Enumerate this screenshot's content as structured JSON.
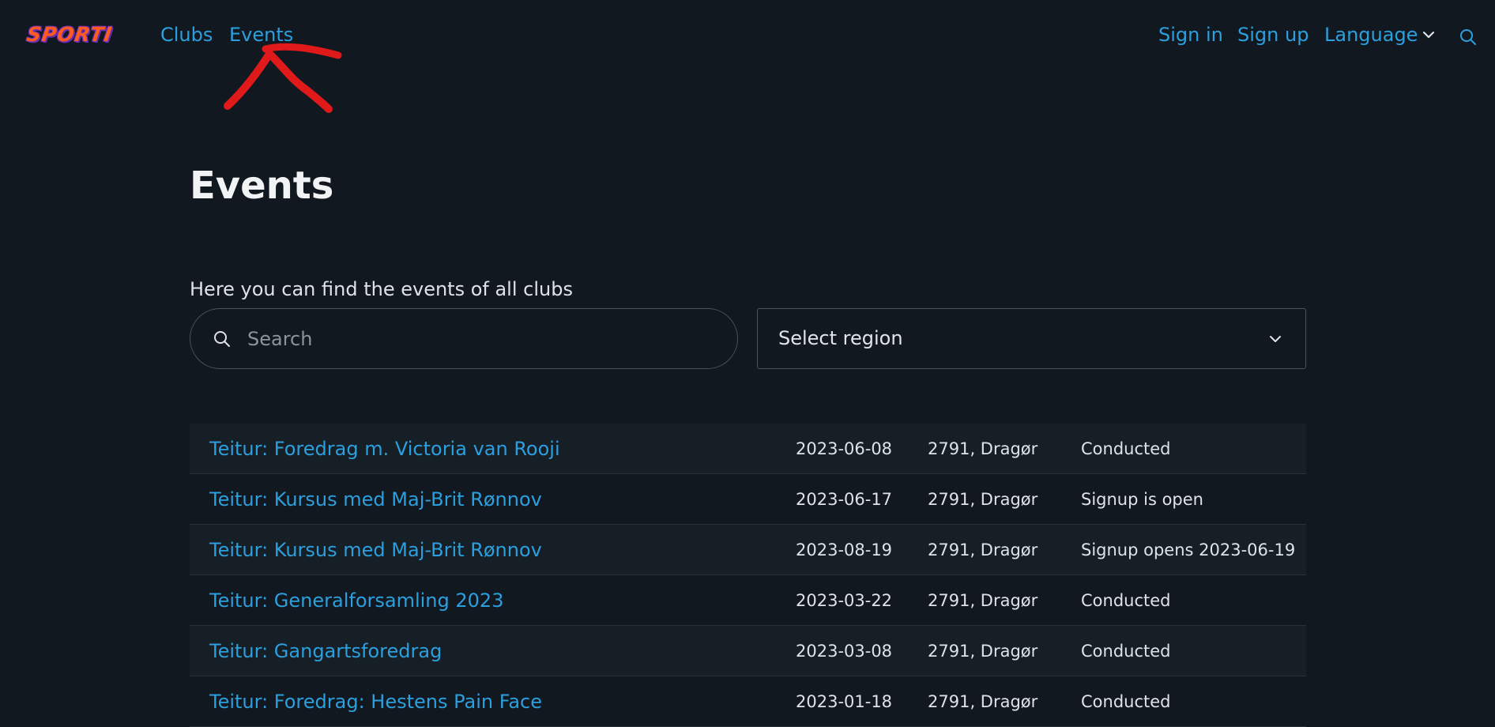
{
  "brand": {
    "logo_text": "SPORTI"
  },
  "nav": {
    "clubs": "Clubs",
    "events": "Events",
    "sign_in": "Sign in",
    "sign_up": "Sign up",
    "language": "Language"
  },
  "page": {
    "title": "Events",
    "intro": "Here you can find the events of all clubs"
  },
  "search": {
    "placeholder": "Search",
    "value": ""
  },
  "region": {
    "selected": "Select region"
  },
  "events": [
    {
      "name": "Teitur: Foredrag m. Victoria van Rooji",
      "date": "2023-06-08",
      "location": "2791, Dragør",
      "status": "Conducted"
    },
    {
      "name": "Teitur: Kursus med Maj-Brit Rønnov",
      "date": "2023-06-17",
      "location": "2791, Dragør",
      "status": "Signup is open"
    },
    {
      "name": "Teitur: Kursus med Maj-Brit Rønnov",
      "date": "2023-08-19",
      "location": "2791, Dragør",
      "status": "Signup opens 2023-06-19"
    },
    {
      "name": "Teitur: Generalforsamling 2023",
      "date": "2023-03-22",
      "location": "2791, Dragør",
      "status": "Conducted"
    },
    {
      "name": "Teitur: Gangartsforedrag",
      "date": "2023-03-08",
      "location": "2791, Dragør",
      "status": "Conducted"
    },
    {
      "name": "Teitur: Foredrag: Hestens Pain Face",
      "date": "2023-01-18",
      "location": "2791, Dragør",
      "status": "Conducted"
    }
  ],
  "colors": {
    "background": "#111820",
    "link": "#2c9fde",
    "annotation": "#e0191b",
    "logo": "#ff5a1f"
  }
}
